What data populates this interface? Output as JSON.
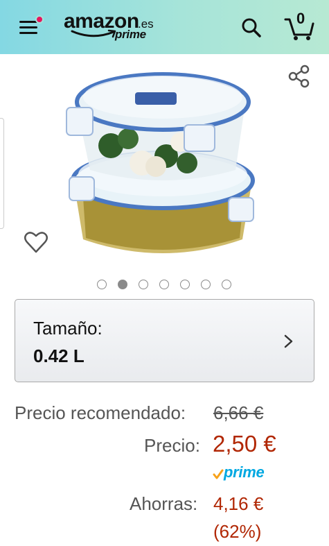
{
  "header": {
    "logo_word": "amazon",
    "logo_tld": ".es",
    "logo_prime": "prime",
    "cart_count": "0"
  },
  "icons": {
    "menu": "hamburger-menu-icon",
    "notification": "notification-dot",
    "search": "search-icon",
    "cart": "cart-icon",
    "share": "share-icon",
    "wishlist": "heart-icon",
    "chevron": "chevron-right-icon"
  },
  "carousel": {
    "total": 7,
    "active_index": 1
  },
  "size": {
    "label": "Tamaño:",
    "value": "0.42 L"
  },
  "pricing": {
    "recommended_label": "Precio recomendado:",
    "recommended_value": "6,66 €",
    "price_label": "Precio:",
    "price_value": "2,50 €",
    "prime_label": "prime",
    "savings_label": "Ahorras:",
    "savings_value": "4,16 €",
    "savings_percent": "(62%)"
  },
  "colors": {
    "header_gradient_start": "#84d8e3",
    "header_gradient_end": "#b7e9d3",
    "price_red": "#b12704",
    "prime_blue": "#00a8e1",
    "prime_check_orange": "#f7a21b",
    "notification_pink": "#e6155f"
  }
}
